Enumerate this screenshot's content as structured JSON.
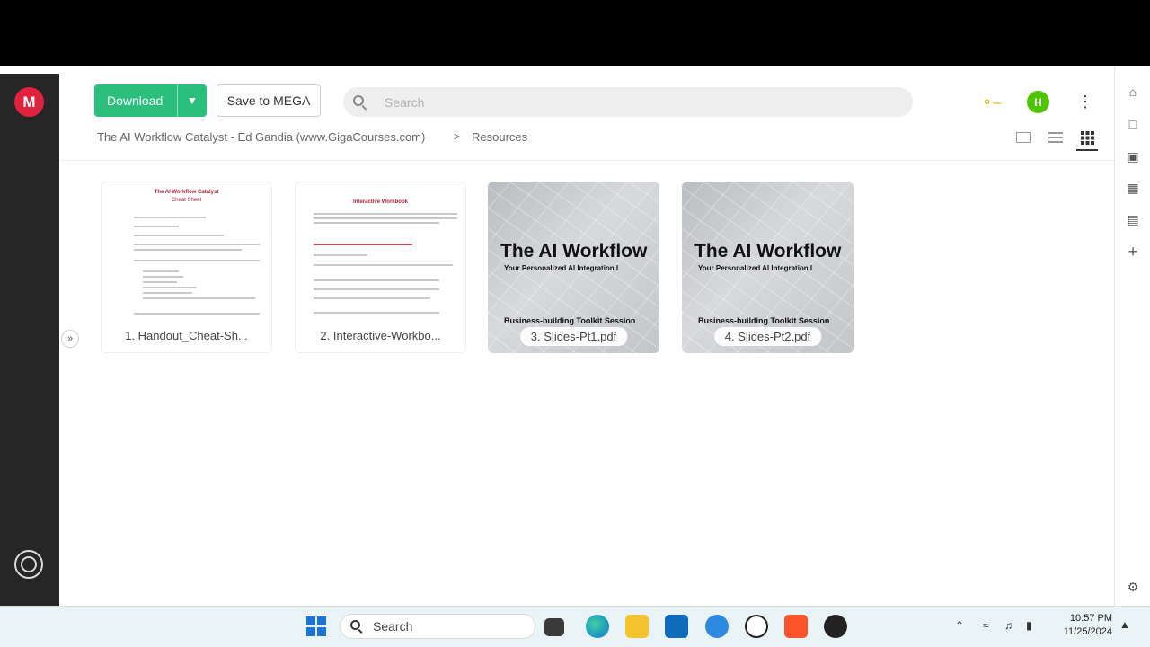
{
  "toolbar": {
    "download_label": "Download",
    "save_label": "Save to MEGA",
    "search_placeholder": "Search",
    "avatar_initial": "H"
  },
  "breadcrumb": {
    "folder": "The AI Workflow Catalyst - Ed Gandia (www.GigaCourses.com)",
    "separator": ">",
    "current": "Resources"
  },
  "files": [
    {
      "name": "1. Handout_Cheat-Sh...",
      "kind": "document",
      "preview_title": "The AI Workflow Catalyst",
      "preview_subtitle": "Cheat Sheet"
    },
    {
      "name": "2. Interactive-Workbo...",
      "kind": "document",
      "preview_title": "Interactive Workbook",
      "preview_subtitle": ""
    },
    {
      "name": "3. Slides-Pt1.pdf",
      "kind": "slides",
      "preview_title": "The AI Workflow",
      "preview_subtitle": "Your Personalized AI Integration I",
      "preview_footer": "Business-building Toolkit Session"
    },
    {
      "name": "4. Slides-Pt2.pdf",
      "kind": "slides",
      "preview_title": "The AI Workflow",
      "preview_subtitle": "Your Personalized AI Integration I",
      "preview_footer": "Business-building Toolkit Session"
    }
  ],
  "taskbar": {
    "search_label": "Search",
    "time": "10:57 PM",
    "date": "11/25/2024"
  },
  "colors": {
    "accent_green": "#2bbf7e",
    "mega_red": "#e0223f",
    "avatar_green": "#4fc400",
    "key_yellow": "#d9b200"
  }
}
